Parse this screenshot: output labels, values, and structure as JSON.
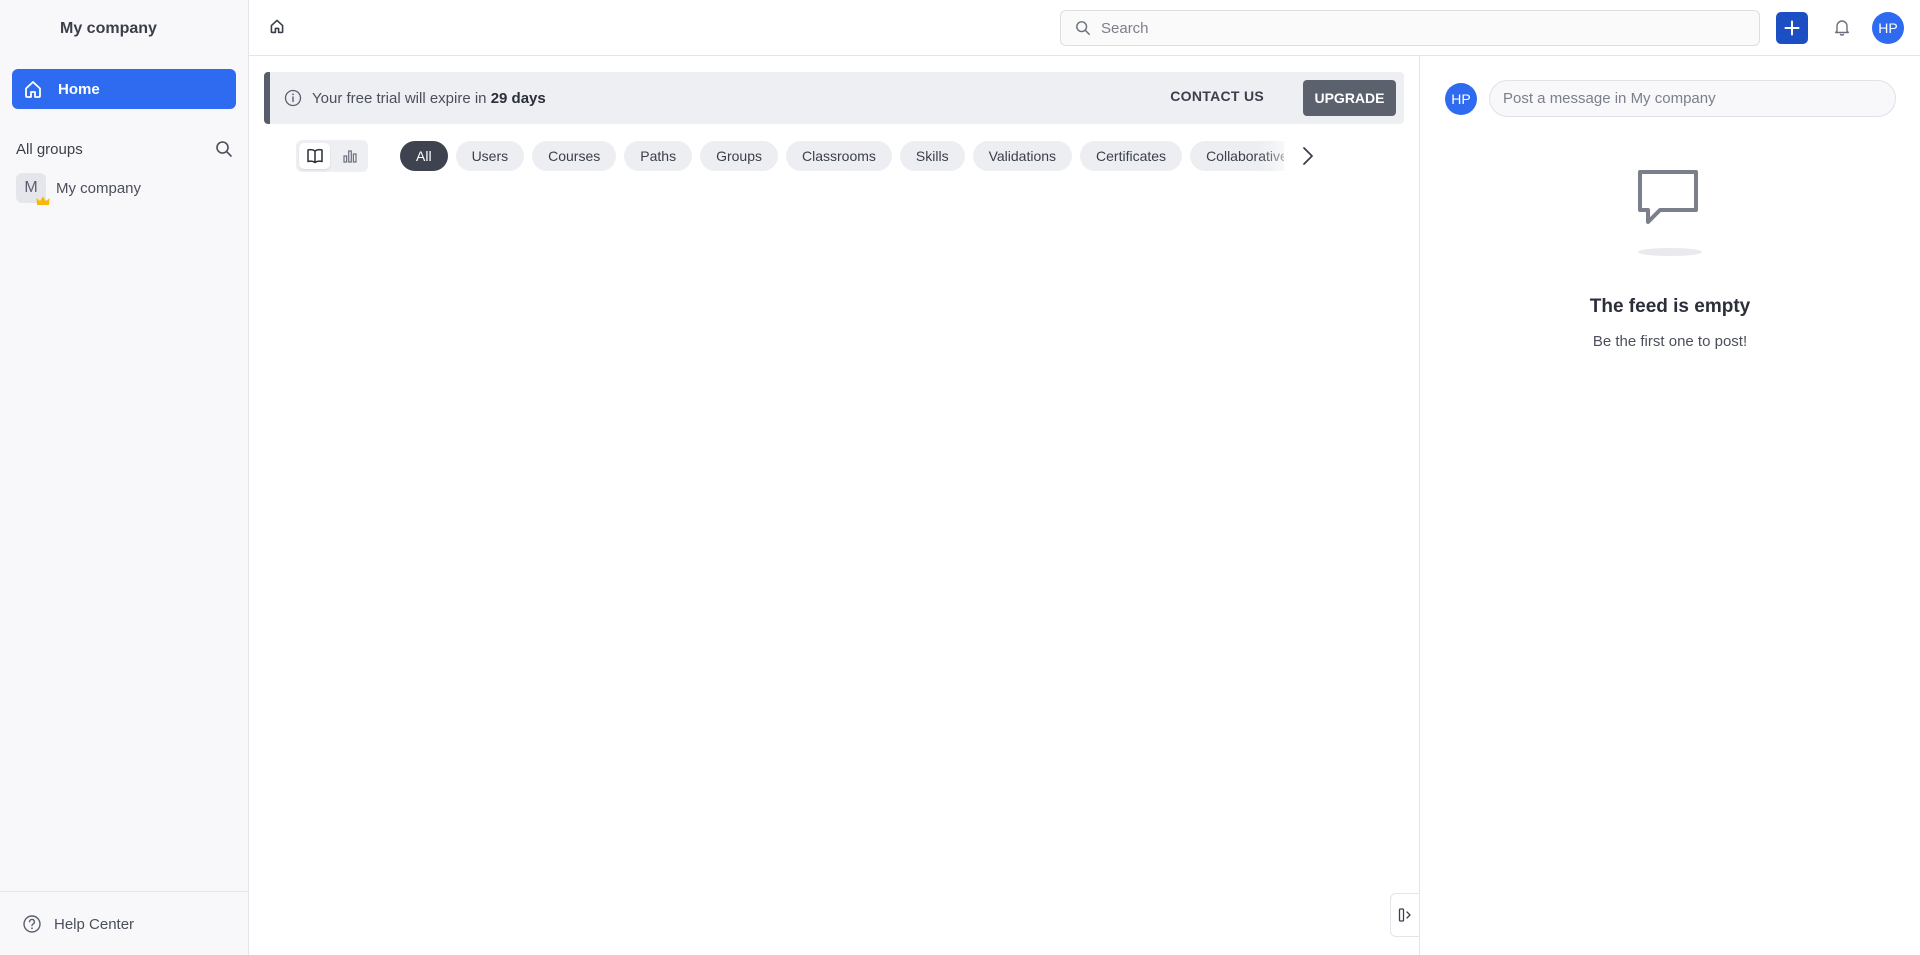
{
  "sidebar": {
    "org_name": "My company",
    "nav_home_label": "Home",
    "groups_title": "All groups",
    "groups": [
      {
        "initial": "M",
        "name": "My company"
      }
    ],
    "help_label": "Help Center"
  },
  "topbar": {
    "search_placeholder": "Search",
    "avatar_initials": "HP"
  },
  "banner": {
    "text_prefix": "Your free trial will expire in ",
    "days": "29 days",
    "contact_label": "CONTACT US",
    "upgrade_label": "UPGRADE"
  },
  "filters": {
    "chips": [
      "All",
      "Users",
      "Courses",
      "Paths",
      "Groups",
      "Classrooms",
      "Skills",
      "Validations",
      "Certificates",
      "Collaborative"
    ],
    "active_index": 0
  },
  "feed": {
    "avatar_initials": "HP",
    "post_placeholder": "Post a message in My company",
    "empty_title": "The feed is empty",
    "empty_subtitle": "Be the first one to post!"
  },
  "colors": {
    "accent": "#2f6bf0",
    "plus_button": "#1d4fc4",
    "active_chip": "#3f4350",
    "upgrade_button": "#5c616e"
  }
}
